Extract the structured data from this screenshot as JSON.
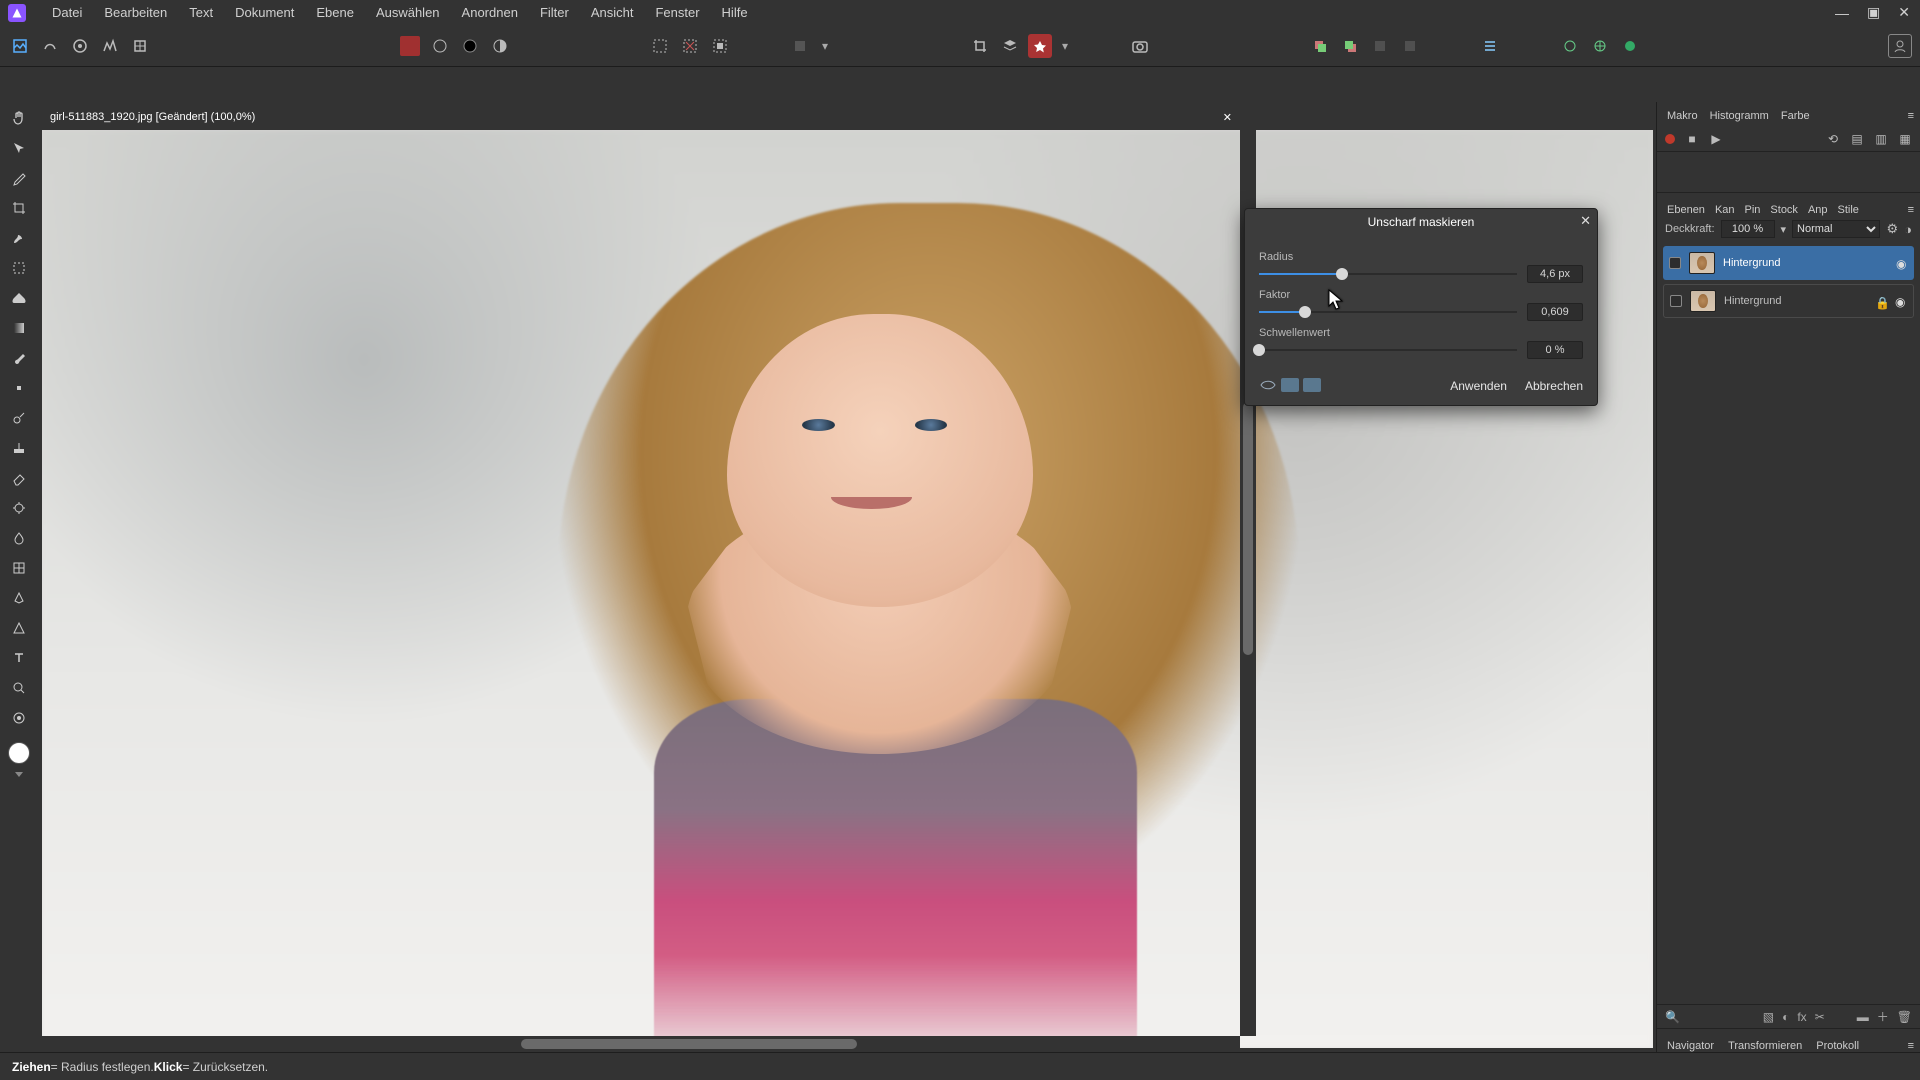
{
  "menu": {
    "items": [
      "Datei",
      "Bearbeiten",
      "Text",
      "Dokument",
      "Ebene",
      "Auswählen",
      "Anordnen",
      "Filter",
      "Ansicht",
      "Fenster",
      "Hilfe"
    ]
  },
  "doc": {
    "title": "girl-511883_1920.jpg [Geändert] (100,0%)"
  },
  "dialog": {
    "title": "Unscharf maskieren",
    "radius_label": "Radius",
    "radius_val": "4,6 px",
    "radius_pct": 32,
    "factor_label": "Faktor",
    "factor_val": "0,609",
    "factor_pct": 18,
    "thresh_label": "Schwellenwert",
    "thresh_val": "0 %",
    "thresh_pct": 0,
    "apply": "Anwenden",
    "cancel": "Abbrechen"
  },
  "panels": {
    "top_tabs": [
      "Makro",
      "Histogramm",
      "Farbe"
    ],
    "layer_tabs": [
      "Ebenen",
      "Kan",
      "Pin",
      "Stock",
      "Anp",
      "Stile"
    ],
    "opacity_label": "Deckkraft:",
    "opacity_val": "100 %",
    "blend": "Normal",
    "layers": [
      {
        "name": "Hintergrund",
        "selected": true,
        "locked": false
      },
      {
        "name": "Hintergrund",
        "selected": false,
        "locked": true
      }
    ],
    "bottom_tabs": [
      "Navigator",
      "Transformieren",
      "Protokoll"
    ]
  },
  "status": {
    "drag": "Ziehen",
    "drag_txt": " = Radius festlegen. ",
    "click": "Klick",
    "click_txt": " = Zurücksetzen."
  }
}
